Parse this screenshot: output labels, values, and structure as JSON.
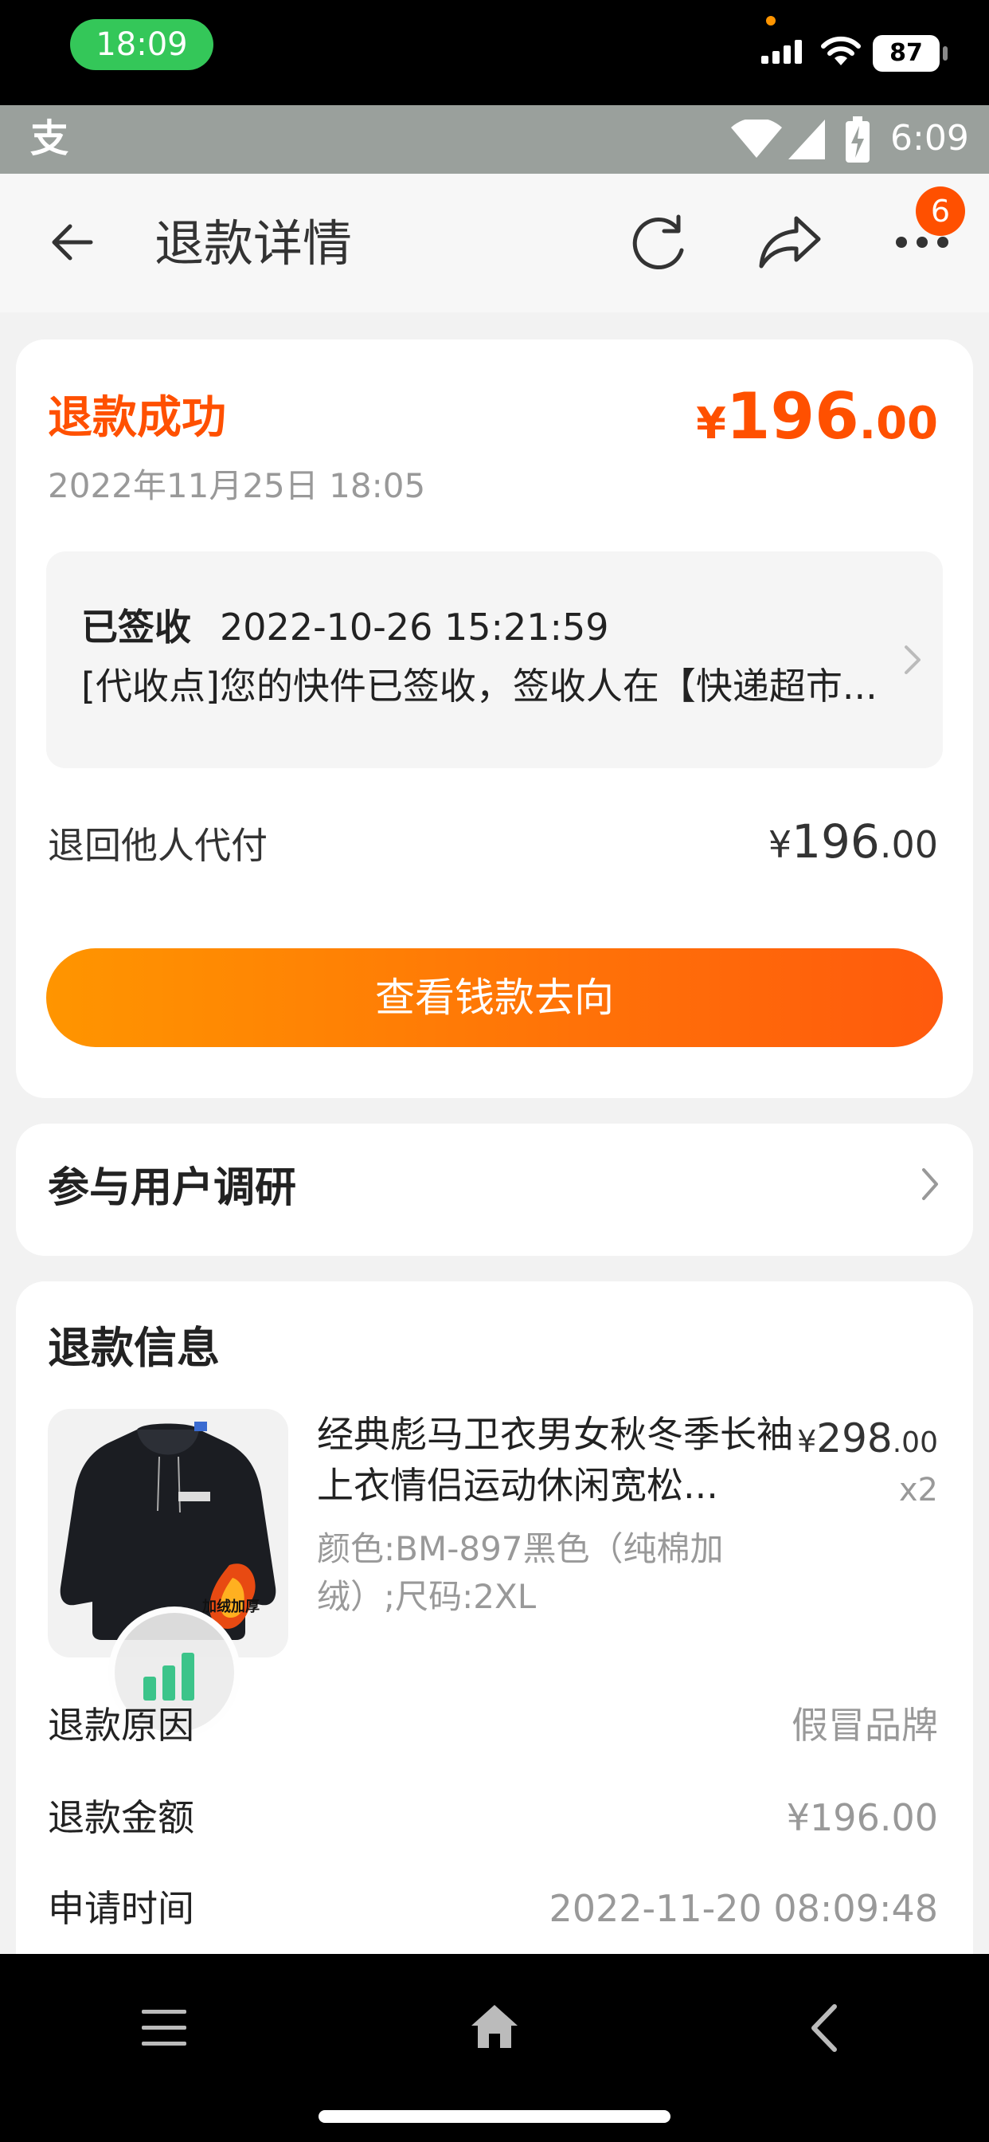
{
  "status_bar": {
    "time": "18:09",
    "battery": "87"
  },
  "android_bar": {
    "app_icon_glyph": "支",
    "time": "6:09"
  },
  "header": {
    "title": "退款详情",
    "more_badge": "6"
  },
  "summary": {
    "status": "退款成功",
    "amount_symbol": "¥",
    "amount_int": "196",
    "amount_dec": ".00",
    "date": "2022年11月25日 18:05"
  },
  "logistics": {
    "status": "已签收",
    "time": "2022-10-26 15:21:59",
    "detail": "[代收点]您的快件已签收，签收人在【快递超市..."
  },
  "payer": {
    "label": "退回他人代付",
    "amount_symbol": "¥",
    "amount_int": "196",
    "amount_dec": ".00"
  },
  "money_button": "查看钱款去向",
  "survey": {
    "label": "参与用户调研"
  },
  "refund_info": {
    "title": "退款信息",
    "product": {
      "name": "经典彪马卫衣男女秋冬季长袖上衣情侣运动休闲宽松...",
      "price_symbol": "¥",
      "price_int": "298",
      "price_dec": ".00",
      "qty": "x2",
      "spec": "颜色:BM-897黑色（纯棉加绒）;尺码:2XL",
      "tag": "加绒加厚"
    },
    "rows": [
      {
        "label": "退款原因",
        "value": "假冒品牌"
      },
      {
        "label": "退款金额",
        "value": "¥196.00"
      },
      {
        "label": "申请时间",
        "value": "2022-11-20 08:09:48"
      }
    ]
  },
  "colors": {
    "accent": "#ff5000",
    "button_start": "#ff9500",
    "button_end": "#ff5a0d",
    "ios_time_pill": "#34c759"
  }
}
